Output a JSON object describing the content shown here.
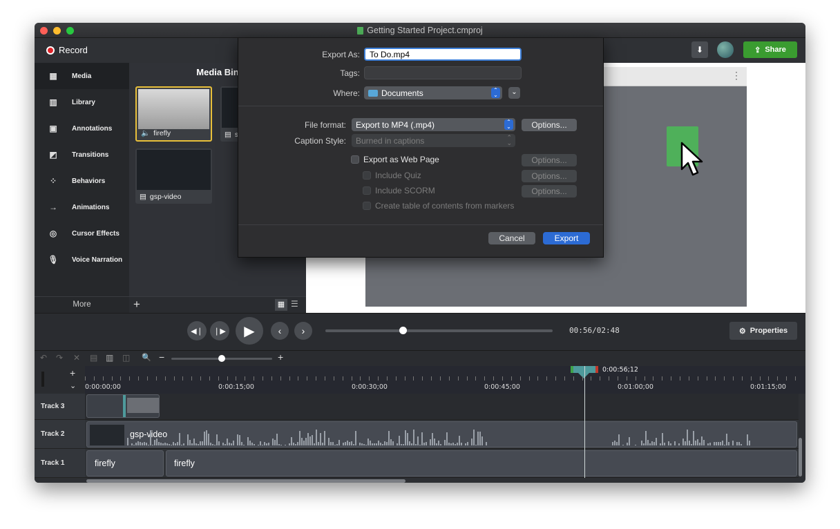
{
  "window": {
    "title": "Getting Started Project.cmproj"
  },
  "toolbar": {
    "record_label": "Record",
    "share_label": "Share"
  },
  "nav": {
    "items": [
      {
        "label": "Media",
        "icon": "film-icon"
      },
      {
        "label": "Library",
        "icon": "books-icon"
      },
      {
        "label": "Annotations",
        "icon": "annotation-icon"
      },
      {
        "label": "Transitions",
        "icon": "transition-icon"
      },
      {
        "label": "Behaviors",
        "icon": "behavior-icon"
      },
      {
        "label": "Animations",
        "icon": "arrow-right-icon"
      },
      {
        "label": "Cursor Effects",
        "icon": "cursor-effects-icon"
      },
      {
        "label": "Voice Narration",
        "icon": "microphone-icon"
      }
    ],
    "more_label": "More"
  },
  "media_bin": {
    "title": "Media Bin",
    "items": [
      {
        "label": "firefly",
        "type": "audio"
      },
      {
        "label": "s",
        "type": "video"
      },
      {
        "label": "gsp-video",
        "type": "video"
      }
    ]
  },
  "dialog": {
    "export_as_label": "Export As:",
    "export_as_value": "To Do.mp4",
    "tags_label": "Tags:",
    "tags_value": "",
    "where_label": "Where:",
    "where_value": "Documents",
    "file_format_label": "File format:",
    "file_format_value": "Export to MP4 (.mp4)",
    "options_label": "Options...",
    "caption_style_label": "Caption Style:",
    "caption_style_value": "Burned in captions",
    "export_web_label": "Export as Web Page",
    "include_quiz_label": "Include Quiz",
    "include_scorm_label": "Include SCORM",
    "toc_label": "Create table of contents from markers",
    "cancel_label": "Cancel",
    "export_label": "Export"
  },
  "player": {
    "time": "00:56/02:48",
    "properties_label": "Properties",
    "progress": 0.34
  },
  "timeline": {
    "playhead_time": "0:00:56;12",
    "ruler_labels": [
      "0:00:00;00",
      "0:00:15;00",
      "0:00:30;00",
      "0:00:45;00",
      "0:01:00;00",
      "0:01:15;00"
    ],
    "tracks": [
      {
        "label": "Track 3"
      },
      {
        "label": "Track 2",
        "clips": [
          "gsp-video"
        ]
      },
      {
        "label": "Track 1",
        "clips": [
          "firefly",
          "firefly"
        ]
      }
    ]
  },
  "colors": {
    "accent": "#2c6bd4",
    "share": "#3a9c30",
    "record": "#e0242a",
    "playhead": "#4e9a9c"
  }
}
